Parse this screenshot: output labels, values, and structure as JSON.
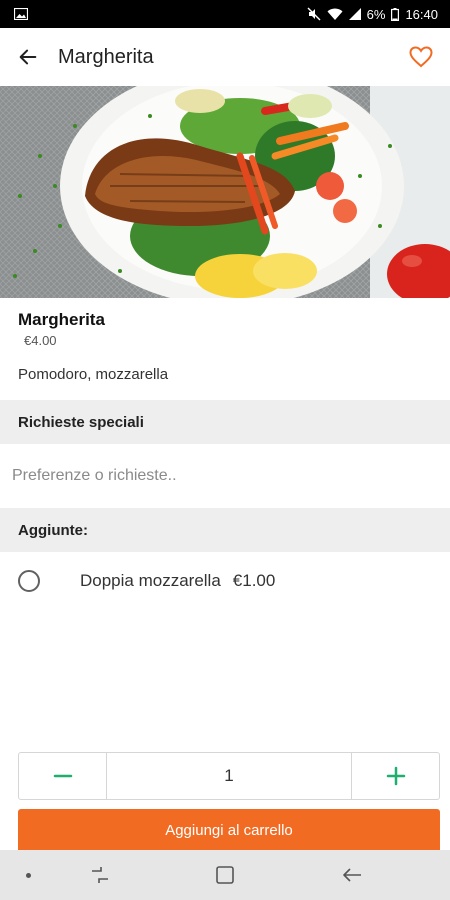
{
  "status_bar": {
    "battery": "6%",
    "time": "16:40",
    "icons": [
      "gallery-icon",
      "mute-icon",
      "wifi-icon",
      "signal-icon",
      "battery-icon"
    ]
  },
  "app_bar": {
    "title": "Margherita",
    "back_icon": "arrow-left-icon",
    "favorite_icon": "heart-outline-icon"
  },
  "product": {
    "image_description": "food-plate-image",
    "name": "Margherita",
    "price": "€4.00",
    "description": "Pomodoro, mozzarella"
  },
  "special_requests": {
    "header": "Richieste speciali",
    "placeholder": "Preferenze o richieste..",
    "value": ""
  },
  "addons": {
    "header": "Aggiunte:",
    "items": [
      {
        "label": "Doppia mozzarella",
        "price": "€1.00",
        "selected": false
      }
    ]
  },
  "quantity": {
    "value": "1",
    "minus_icon": "minus-icon",
    "plus_icon": "plus-icon"
  },
  "cta": {
    "label": "Aggiungi al carrello"
  },
  "colors": {
    "accent": "#f26b23",
    "quantity_icons": "#1fae6e",
    "section_bg": "#eeeeee"
  },
  "nav_bar": {
    "icons": [
      "recent-apps-icon",
      "home-icon",
      "back-icon"
    ]
  }
}
